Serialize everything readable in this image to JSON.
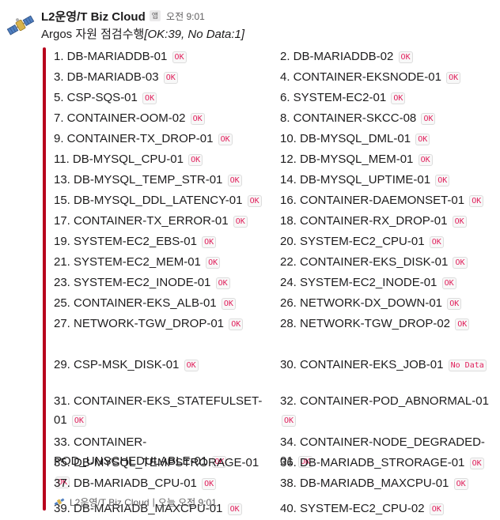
{
  "message": {
    "sender": "L2운영/T Biz Cloud",
    "app_badge": "앱",
    "time": "오전 9:01",
    "summary_prefix": "Argos 자원 점검수행",
    "summary_bracket": "[OK:39, No Data:1]",
    "items": [
      {
        "text": "1. DB-MARIADDB-01",
        "status": "OK"
      },
      {
        "text": "2. DB-MARIADDB-02",
        "status": "OK"
      },
      {
        "text": "3. DB-MARIADB-03",
        "status": "OK"
      },
      {
        "text": "4. CONTAINER-EKSNODE-01",
        "status": "OK"
      },
      {
        "text": "5. CSP-SQS-01",
        "status": "OK"
      },
      {
        "text": "6. SYSTEM-EC2-01",
        "status": "OK"
      },
      {
        "text": "7. CONTAINER-OOM-02",
        "status": "OK"
      },
      {
        "text": "8. CONTAINER-SKCC-08",
        "status": "OK"
      },
      {
        "text": "9. CONTAINER-TX_DROP-01",
        "status": "OK"
      },
      {
        "text": "10. DB-MYSQL_DML-01",
        "status": "OK"
      },
      {
        "text": "11. DB-MYSQL_CPU-01",
        "status": "OK"
      },
      {
        "text": "12. DB-MYSQL_MEM-01",
        "status": "OK"
      },
      {
        "text": "13. DB-MYSQL_TEMP_STR-01",
        "status": "OK"
      },
      {
        "text": "14. DB-MYSQL_UPTIME-01",
        "status": "OK"
      },
      {
        "text": "15. DB-MYSQL_DDL_LATENCY-01",
        "status": "OK"
      },
      {
        "text": "16. CONTAINER-DAEMONSET-01",
        "status": "OK"
      },
      {
        "text": "17. CONTAINER-TX_ERROR-01",
        "status": "OK"
      },
      {
        "text": "18. CONTAINER-RX_DROP-01",
        "status": "OK"
      },
      {
        "text": "19. SYSTEM-EC2_EBS-01",
        "status": "OK"
      },
      {
        "text": "20. SYSTEM-EC2_CPU-01",
        "status": "OK"
      },
      {
        "text": "21. SYSTEM-EC2_MEM-01",
        "status": "OK"
      },
      {
        "text": "22. CONTAINER-EKS_DISK-01",
        "status": "OK"
      },
      {
        "text": "23. SYSTEM-EC2_INODE-01",
        "status": "OK"
      },
      {
        "text": "24. SYSTEM-EC2_INODE-01",
        "status": "OK"
      },
      {
        "text": "25. CONTAINER-EKS_ALB-01",
        "status": "OK"
      },
      {
        "text": "26. NETWORK-DX_DOWN-01",
        "status": "OK"
      },
      {
        "text": "27. NETWORK-TGW_DROP-01",
        "status": "OK"
      },
      {
        "text": "28. NETWORK-TGW_DROP-02",
        "status": "OK"
      },
      {
        "text": "29. CSP-MSK_DISK-01",
        "status": "OK"
      },
      {
        "text": "30. CONTAINER-EKS_JOB-01",
        "status": "No Data"
      },
      {
        "text": "31. CONTAINER-EKS_STATEFULSET-01",
        "status": "OK"
      },
      {
        "text": "32. CONTAINER-POD_ABNORMAL-01",
        "status": "OK"
      },
      {
        "text": "33. CONTAINER-POD_UNSCHEDULABLE-01",
        "status": "OK"
      },
      {
        "text": "34. CONTAINER-NODE_DEGRADED-01",
        "status": "OK"
      },
      {
        "text": "35. DB-MYSQL_TEMPSTRORAGE-01",
        "status": "OK"
      },
      {
        "text": "36. DB-MARIADB_STRORAGE-01",
        "status": "OK"
      },
      {
        "text": "37. DB-MARIADB_CPU-01",
        "status": "OK"
      },
      {
        "text": "38. DB-MARIADB_MAXCPU-01",
        "status": "OK"
      },
      {
        "text": "39. DB-MARIADB_MAXCPU-01",
        "status": "OK"
      },
      {
        "text": "40. SYSTEM-EC2_CPU-02",
        "status": "OK"
      }
    ],
    "footer": {
      "sender": "L2운영/T Biz Cloud",
      "separator": "|",
      "time": "오늘 오전 9:01"
    }
  },
  "colors": {
    "accent_bar": "#b8001c",
    "status_text": "#e01e5a"
  },
  "icons": {
    "avatar": "satellite-icon",
    "footer": "satellite-icon"
  }
}
